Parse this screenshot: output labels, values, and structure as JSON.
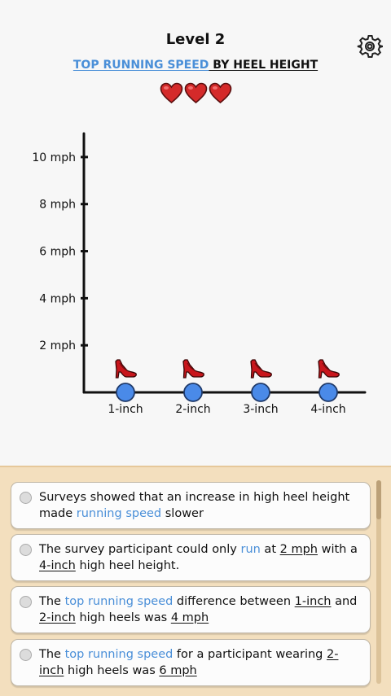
{
  "header": {
    "level_label": "Level 2",
    "title_highlight": "TOP RUNNING SPEED",
    "title_rest": " BY HEEL HEIGHT",
    "lives": 3,
    "settings_icon": "gear-icon",
    "heart_icon": "heart-icon"
  },
  "chart_data": {
    "type": "scatter",
    "categories": [
      "1-inch",
      "2-inch",
      "3-inch",
      "4-inch"
    ],
    "values": [
      0,
      0,
      0,
      0
    ],
    "y_ticks": [
      "2 mph",
      "4 mph",
      "6 mph",
      "8 mph",
      "10 mph"
    ],
    "ylim": [
      0,
      11
    ],
    "title": "",
    "xlabel": "",
    "ylabel": "",
    "marker_icon": "high-heel-icon",
    "point_color": "#4a8ae8"
  },
  "options": [
    {
      "parts": [
        {
          "t": "Surveys showed that an increase in high heel height made "
        },
        {
          "t": "running speed",
          "s": "blue"
        },
        {
          "t": " slower"
        }
      ]
    },
    {
      "parts": [
        {
          "t": "The survey participant could only "
        },
        {
          "t": "run",
          "s": "blue"
        },
        {
          "t": " at "
        },
        {
          "t": "2 mph",
          "s": "ul"
        },
        {
          "t": " with a "
        },
        {
          "t": "4-inch",
          "s": "ul"
        },
        {
          "t": " high heel height."
        }
      ]
    },
    {
      "parts": [
        {
          "t": "The "
        },
        {
          "t": "top running speed",
          "s": "blue"
        },
        {
          "t": " difference between "
        },
        {
          "t": "1-inch",
          "s": "ul"
        },
        {
          "t": " and "
        },
        {
          "t": "2-inch",
          "s": "ul"
        },
        {
          "t": " high heels was "
        },
        {
          "t": "4 mph",
          "s": "ul"
        }
      ]
    },
    {
      "parts": [
        {
          "t": "The "
        },
        {
          "t": "top running speed",
          "s": "blue"
        },
        {
          "t": " for a participant wearing "
        },
        {
          "t": "2-inch",
          "s": "ul"
        },
        {
          "t": " high heels was "
        },
        {
          "t": "6 mph",
          "s": "ul"
        }
      ]
    }
  ],
  "colors": {
    "accent": "#4a8fd8",
    "heart": "#d42a2a",
    "panel": "#f3dfbe"
  }
}
